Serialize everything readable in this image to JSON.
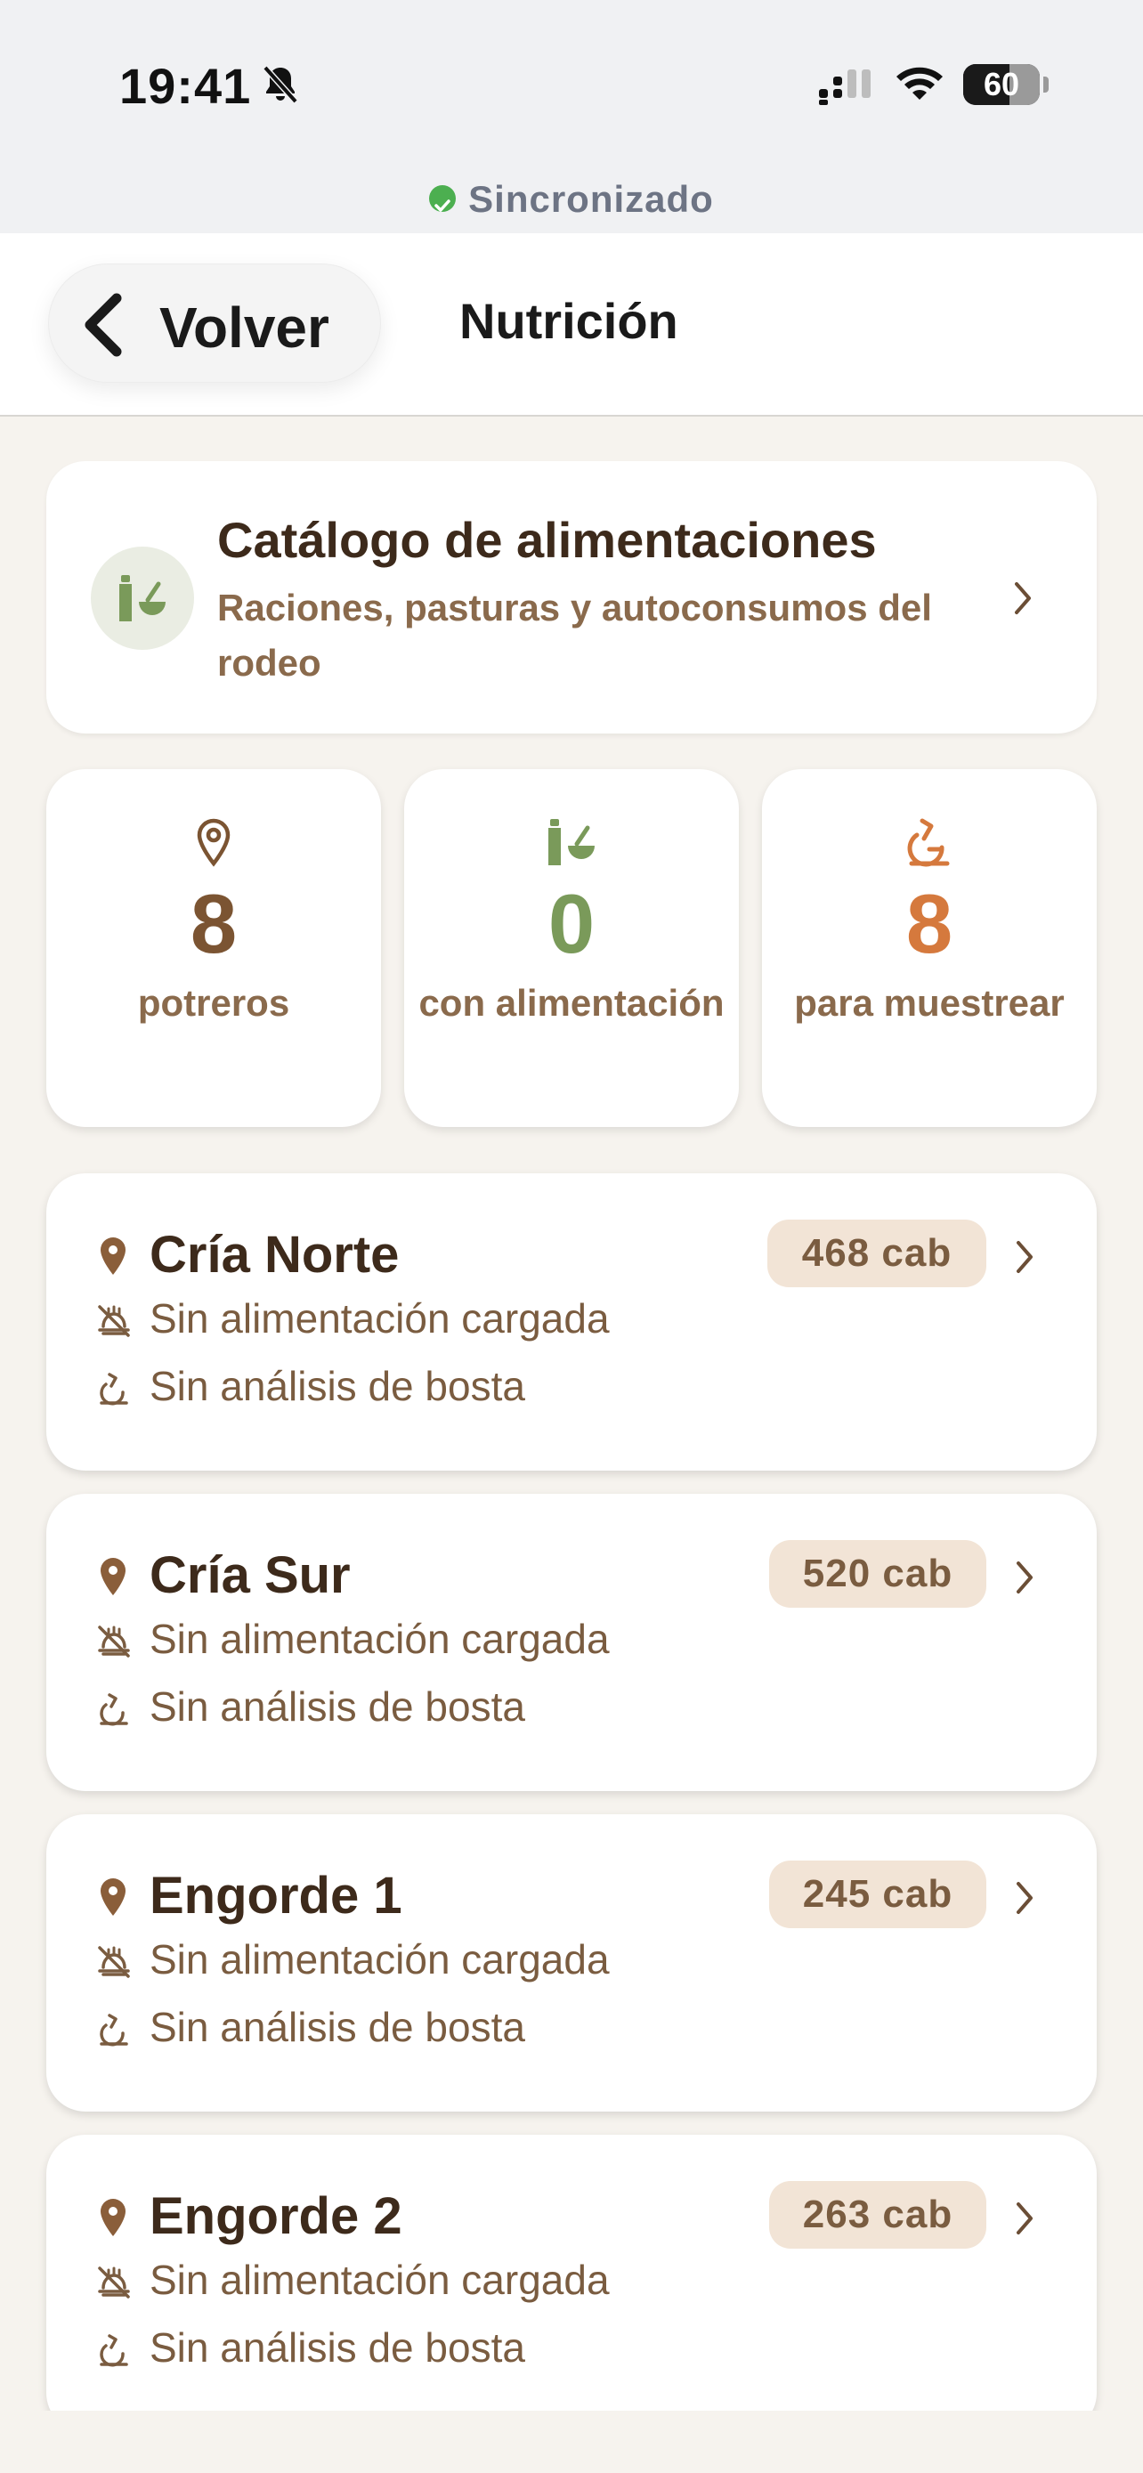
{
  "status_bar": {
    "time": "19:41",
    "battery": "60",
    "battery_level": 0.6
  },
  "sync": {
    "label": "Sincronizado"
  },
  "header": {
    "back_label": "Volver",
    "title": "Nutrición"
  },
  "catalog": {
    "title": "Catálogo de alimentaciones",
    "subtitle": "Raciones, pasturas y autoconsumos del rodeo"
  },
  "stats": [
    {
      "value": "8",
      "label": "potreros",
      "color": "#7b5432",
      "icon": "map-pin-icon"
    },
    {
      "value": "0",
      "label": "con alimentación",
      "color": "#7a9a5a",
      "icon": "feed-icon"
    },
    {
      "value": "8",
      "label": "para muestrear",
      "color": "#d5793d",
      "icon": "microscope-icon"
    }
  ],
  "potreros": [
    {
      "name": "Cría Norte",
      "heads": "468 cab",
      "feed_status": "Sin alimentación cargada",
      "analysis_status": "Sin análisis de bosta"
    },
    {
      "name": "Cría Sur",
      "heads": "520 cab",
      "feed_status": "Sin alimentación cargada",
      "analysis_status": "Sin análisis de bosta"
    },
    {
      "name": "Engorde 1",
      "heads": "245 cab",
      "feed_status": "Sin alimentación cargada",
      "analysis_status": "Sin análisis de bosta"
    },
    {
      "name": "Engorde 2",
      "heads": "263 cab",
      "feed_status": "Sin alimentación cargada",
      "analysis_status": "Sin análisis de bosta"
    }
  ],
  "colors": {
    "brown": "#7b5432",
    "green": "#7a9a5a",
    "orange": "#d5793d",
    "background": "#f6f3ee"
  }
}
